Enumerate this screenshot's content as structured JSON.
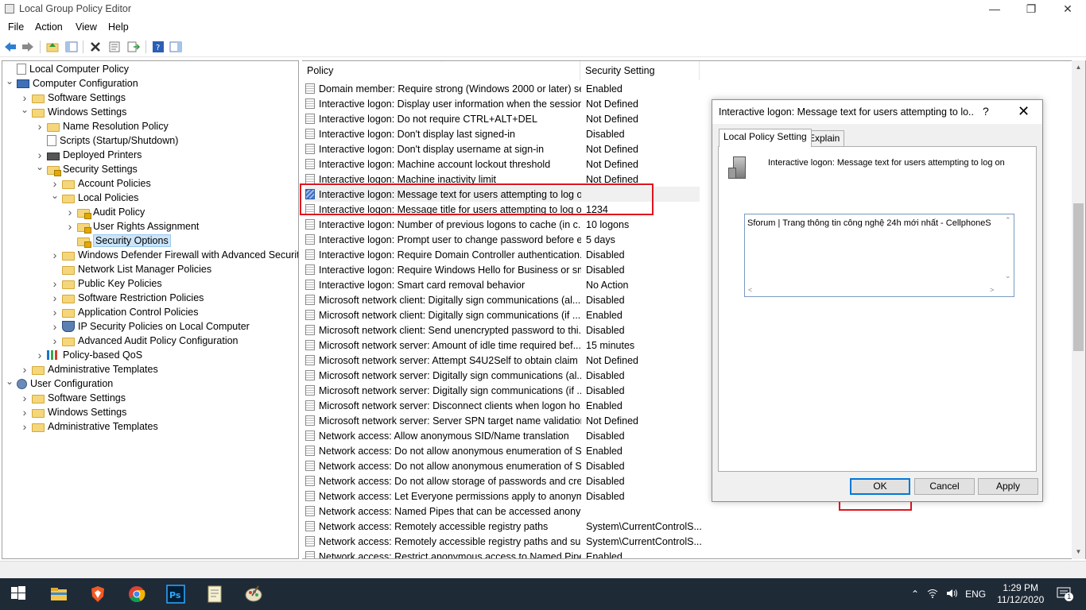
{
  "window": {
    "title": "Local Group Policy Editor"
  },
  "menu": [
    "File",
    "Action",
    "View",
    "Help"
  ],
  "tree": [
    {
      "label": "Local Computer Policy",
      "icon": "document-icon",
      "level": 0,
      "toggle": ""
    },
    {
      "label": "Computer Configuration",
      "icon": "computer-icon",
      "level": 0,
      "toggle": "v"
    },
    {
      "label": "Software Settings",
      "icon": "folder-icon",
      "level": 1,
      "toggle": ">"
    },
    {
      "label": "Windows Settings",
      "icon": "folder-icon",
      "level": 1,
      "toggle": "v"
    },
    {
      "label": "Name Resolution Policy",
      "icon": "folder-icon",
      "level": 2,
      "toggle": ">"
    },
    {
      "label": "Scripts (Startup/Shutdown)",
      "icon": "document-icon",
      "level": 2,
      "toggle": ""
    },
    {
      "label": "Deployed Printers",
      "icon": "printer-icon",
      "level": 2,
      "toggle": ">"
    },
    {
      "label": "Security Settings",
      "icon": "security-folder-icon",
      "level": 2,
      "toggle": "v"
    },
    {
      "label": "Account Policies",
      "icon": "folder-icon",
      "level": 3,
      "toggle": ">"
    },
    {
      "label": "Local Policies",
      "icon": "folder-icon",
      "level": 3,
      "toggle": "v"
    },
    {
      "label": "Audit Policy",
      "icon": "locked-folder-icon",
      "level": 4,
      "toggle": ">"
    },
    {
      "label": "User Rights Assignment",
      "icon": "locked-folder-icon",
      "level": 4,
      "toggle": ">"
    },
    {
      "label": "Security Options",
      "icon": "locked-folder-icon",
      "level": 4,
      "toggle": "",
      "selected": true
    },
    {
      "label": "Windows Defender Firewall with Advanced Security",
      "icon": "folder-icon",
      "level": 3,
      "toggle": ">"
    },
    {
      "label": "Network List Manager Policies",
      "icon": "folder-icon",
      "level": 3,
      "toggle": ""
    },
    {
      "label": "Public Key Policies",
      "icon": "folder-icon",
      "level": 3,
      "toggle": ">"
    },
    {
      "label": "Software Restriction Policies",
      "icon": "folder-icon",
      "level": 3,
      "toggle": ">"
    },
    {
      "label": "Application Control Policies",
      "icon": "folder-icon",
      "level": 3,
      "toggle": ">"
    },
    {
      "label": "IP Security Policies on Local Computer",
      "icon": "shield-icon",
      "level": 3,
      "toggle": ">"
    },
    {
      "label": "Advanced Audit Policy Configuration",
      "icon": "folder-icon",
      "level": 3,
      "toggle": ">"
    },
    {
      "label": "Policy-based QoS",
      "icon": "bar-chart-icon",
      "level": 2,
      "toggle": ">"
    },
    {
      "label": "Administrative Templates",
      "icon": "folder-icon",
      "level": 1,
      "toggle": ">"
    },
    {
      "label": "User Configuration",
      "icon": "user-icon",
      "level": 0,
      "toggle": "v"
    },
    {
      "label": "Software Settings",
      "icon": "folder-icon",
      "level": 1,
      "toggle": ">"
    },
    {
      "label": "Windows Settings",
      "icon": "folder-icon",
      "level": 1,
      "toggle": ">"
    },
    {
      "label": "Administrative Templates",
      "icon": "folder-icon",
      "level": 1,
      "toggle": ">"
    }
  ],
  "columns": {
    "policy": "Policy",
    "setting": "Security Setting"
  },
  "policies": [
    {
      "name": "Domain member: Require strong (Windows 2000 or later) se...",
      "value": "Enabled"
    },
    {
      "name": "Interactive logon: Display user information when the session...",
      "value": "Not Defined"
    },
    {
      "name": "Interactive logon: Do not require CTRL+ALT+DEL",
      "value": "Not Defined"
    },
    {
      "name": "Interactive logon: Don't display last signed-in",
      "value": "Disabled"
    },
    {
      "name": "Interactive logon: Don't display username at sign-in",
      "value": "Not Defined"
    },
    {
      "name": "Interactive logon: Machine account lockout threshold",
      "value": "Not Defined"
    },
    {
      "name": "Interactive logon: Machine inactivity limit",
      "value": "Not Defined"
    },
    {
      "name": "Interactive logon: Message text for users attempting to log on",
      "value": "",
      "active": true
    },
    {
      "name": "Interactive logon: Message title for users attempting to log on",
      "value": "1234"
    },
    {
      "name": "Interactive logon: Number of previous logons to cache (in c...",
      "value": "10 logons"
    },
    {
      "name": "Interactive logon: Prompt user to change password before e...",
      "value": "5 days"
    },
    {
      "name": "Interactive logon: Require Domain Controller authentication...",
      "value": "Disabled"
    },
    {
      "name": "Interactive logon: Require Windows Hello for Business or sm...",
      "value": "Disabled"
    },
    {
      "name": "Interactive logon: Smart card removal behavior",
      "value": "No Action"
    },
    {
      "name": "Microsoft network client: Digitally sign communications (al...",
      "value": "Disabled"
    },
    {
      "name": "Microsoft network client: Digitally sign communications (if ...",
      "value": "Enabled"
    },
    {
      "name": "Microsoft network client: Send unencrypted password to thi...",
      "value": "Disabled"
    },
    {
      "name": "Microsoft network server: Amount of idle time required bef...",
      "value": "15 minutes"
    },
    {
      "name": "Microsoft network server: Attempt S4U2Self to obtain claim ...",
      "value": "Not Defined"
    },
    {
      "name": "Microsoft network server: Digitally sign communications (al...",
      "value": "Disabled"
    },
    {
      "name": "Microsoft network server: Digitally sign communications (if ...",
      "value": "Disabled"
    },
    {
      "name": "Microsoft network server: Disconnect clients when logon ho...",
      "value": "Enabled"
    },
    {
      "name": "Microsoft network server: Server SPN target name validation...",
      "value": "Not Defined"
    },
    {
      "name": "Network access: Allow anonymous SID/Name translation",
      "value": "Disabled"
    },
    {
      "name": "Network access: Do not allow anonymous enumeration of S...",
      "value": "Enabled"
    },
    {
      "name": "Network access: Do not allow anonymous enumeration of S...",
      "value": "Disabled"
    },
    {
      "name": "Network access: Do not allow storage of passwords and cre...",
      "value": "Disabled"
    },
    {
      "name": "Network access: Let Everyone permissions apply to anonym...",
      "value": "Disabled"
    },
    {
      "name": "Network access: Named Pipes that can be accessed anonym...",
      "value": ""
    },
    {
      "name": "Network access: Remotely accessible registry paths",
      "value": "System\\CurrentControlS..."
    },
    {
      "name": "Network access: Remotely accessible registry paths and sub...",
      "value": "System\\CurrentControlS..."
    },
    {
      "name": "Network access: Restrict anonymous access to Named Pipes...",
      "value": "Enabled"
    }
  ],
  "dialog": {
    "title": "Interactive logon: Message text for users attempting to lo...",
    "help": "?",
    "close": "✕",
    "tabs": [
      "Local Policy Setting",
      "Explain"
    ],
    "policy_name": "Interactive logon: Message text for users attempting to log on",
    "text_value": "Sforum | Trang thông tin công nghệ 24h mới nhất - CellphoneS",
    "ok": "OK",
    "cancel": "Cancel",
    "apply": "Apply"
  },
  "taskbar": {
    "lang": "ENG",
    "time": "1:29 PM",
    "date": "11/12/2020",
    "notifications": "1"
  },
  "colors": {
    "highlight_box": "#e0141e",
    "selected_bg": "#cce4f7",
    "taskbar_bg": "#1f2a37",
    "accent": "#0078d7"
  }
}
